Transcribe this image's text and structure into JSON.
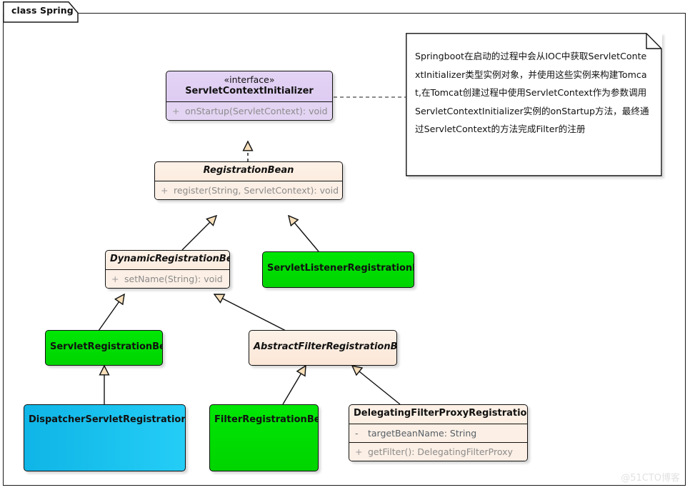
{
  "diagram": {
    "title": "class Spring",
    "watermark": "@51CTO博客"
  },
  "note": {
    "text": "Springboot在启动的过程中会从IOC中获取ServletContextInitializer类型实例对象，并使用这些实例来构建Tomcat,在Tomcat创建过程中使用ServletContext作为参数调用ServletContextInitializer实例的onStartup方法，最终通过ServletContext的方法完成Filter的注册"
  },
  "classes": {
    "servlet_context_initializer": {
      "stereotype": "«interface»",
      "name": "ServletContextInitializer",
      "members": [
        {
          "visibility": "+",
          "text": "onStartup(ServletContext): void"
        }
      ]
    },
    "registration_bean": {
      "name": "RegistrationBean",
      "members": [
        {
          "visibility": "+",
          "text": "register(String, ServletContext): void"
        }
      ]
    },
    "dynamic_registration_bean": {
      "name": "DynamicRegistrationBean",
      "members": [
        {
          "visibility": "+",
          "text": "setName(String): void"
        }
      ]
    },
    "servlet_listener_registration_bean": {
      "name": "ServletListenerRegistrationBean",
      "members": []
    },
    "servlet_registration_bean": {
      "name": "ServletRegistrationBean",
      "members": []
    },
    "abstract_filter_registration_bean": {
      "name": "AbstractFilterRegistrationBean",
      "members": []
    },
    "dispatcher_servlet_registration_bean": {
      "name": "DispatcherServletRegistrationBean",
      "members": []
    },
    "filter_registration_bean": {
      "name": "FilterRegistrationBean",
      "members": []
    },
    "delegating_filter_proxy_registration_bean": {
      "name": "DelegatingFilterProxyRegistrationBean",
      "members": [
        {
          "visibility": "-",
          "text": "targetBeanName: String"
        },
        {
          "visibility": "+",
          "text": "getFilter(): DelegatingFilterProxy"
        }
      ]
    }
  },
  "colors": {
    "interface_fill": "#dbc7f0",
    "abstract_fill": "#fbe7d7",
    "green_fill": "#00d400",
    "cyan_fill": "#1fc2ef",
    "arrow_fill": "#f7dfba",
    "border": "#111111"
  }
}
